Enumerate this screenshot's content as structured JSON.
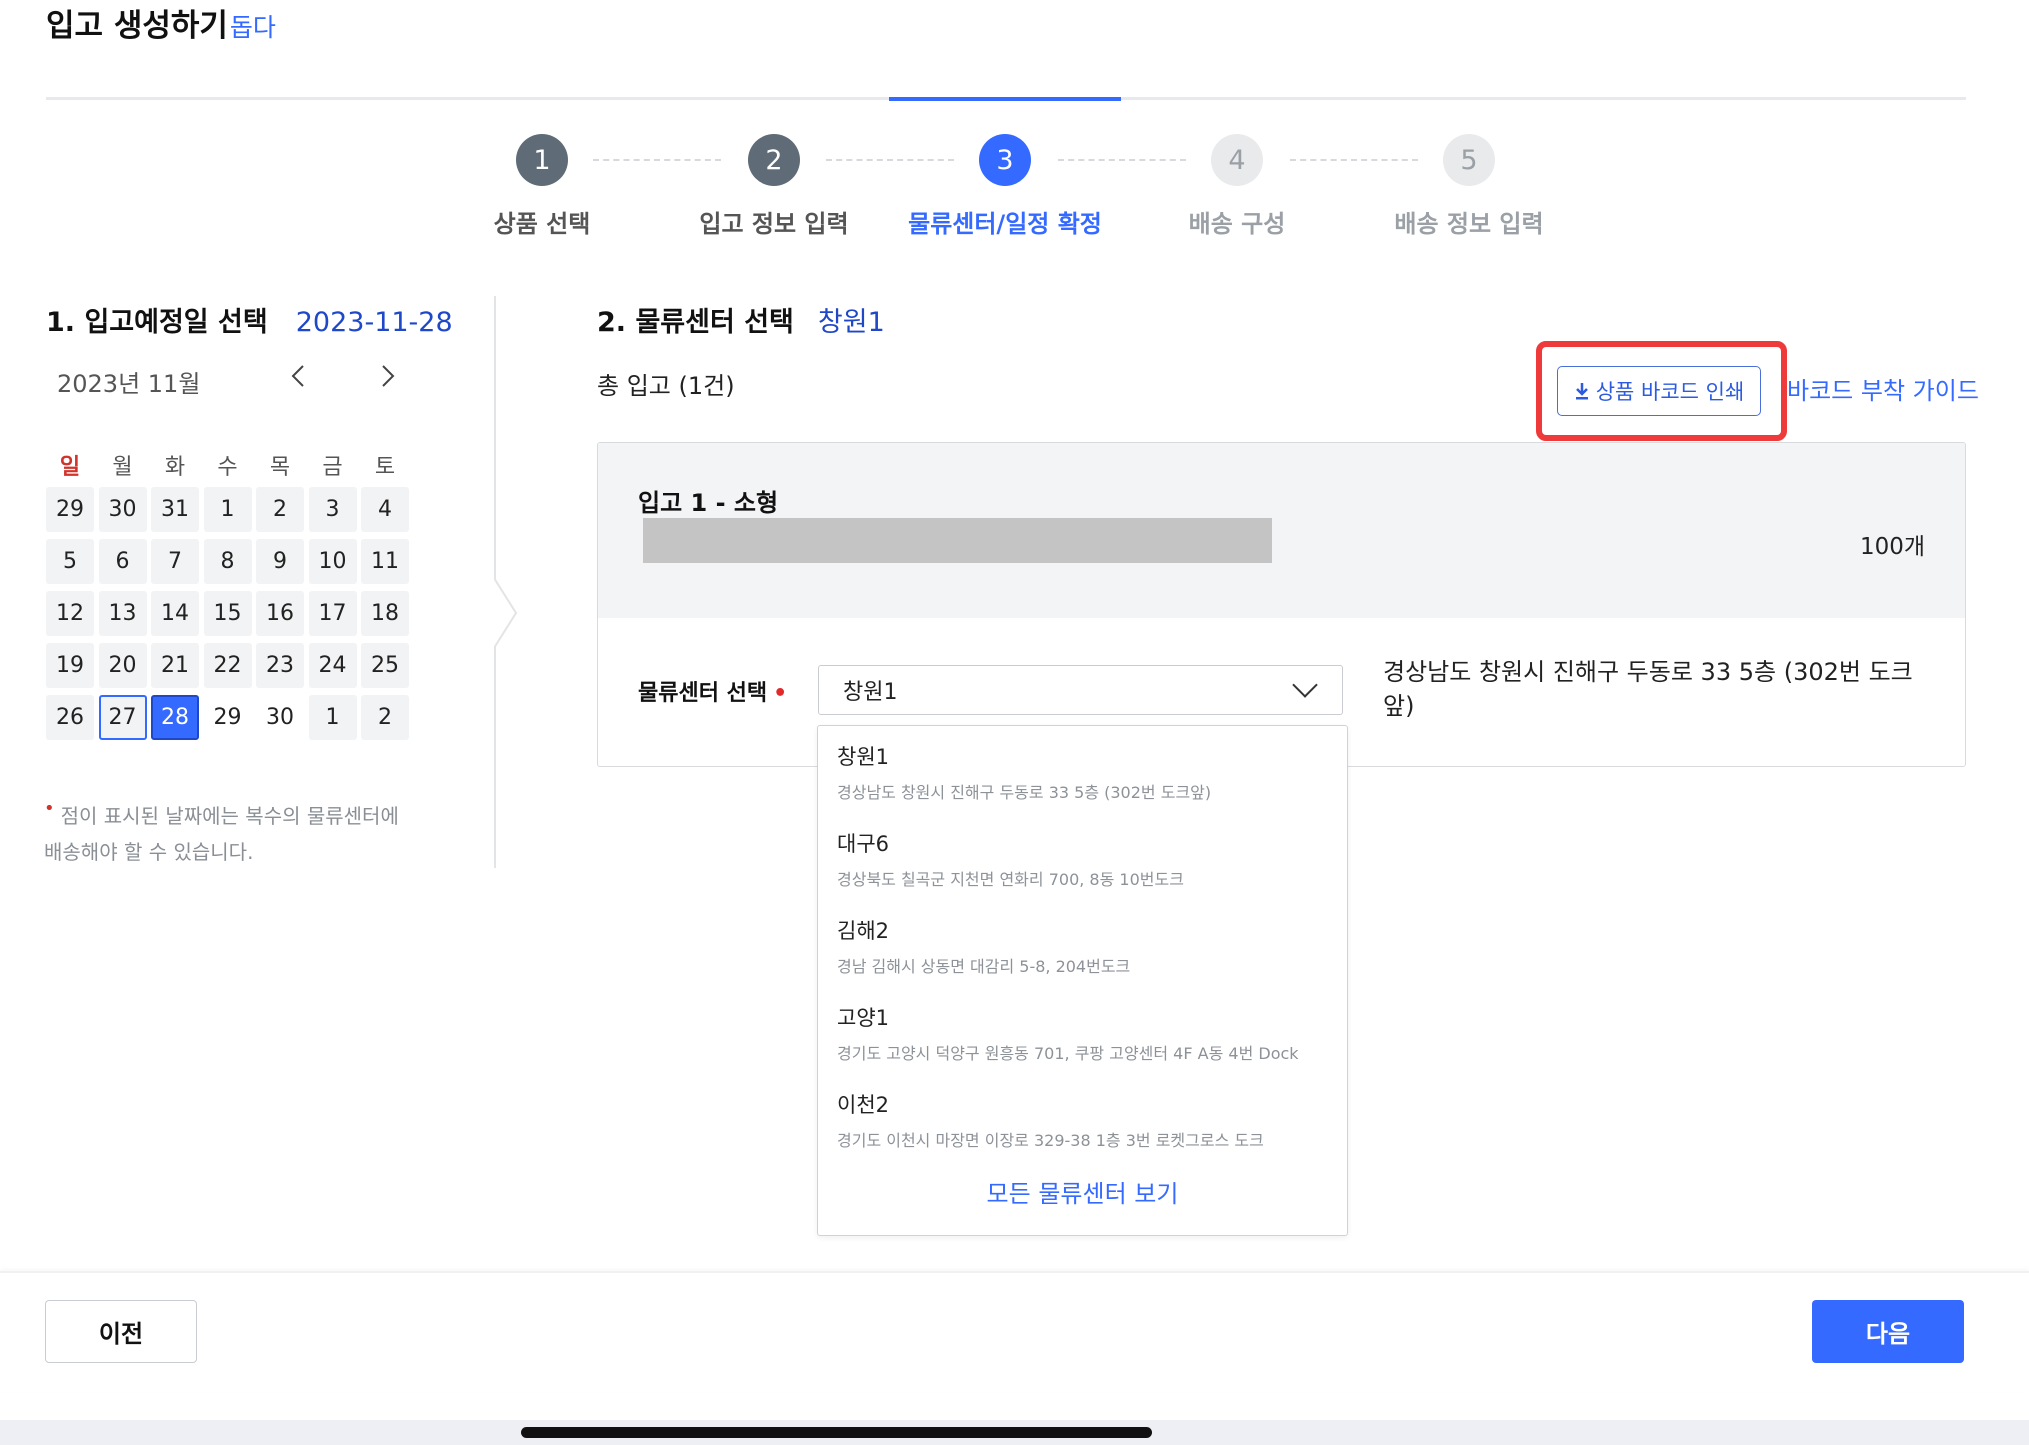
{
  "page": {
    "title": "입고 생성하기",
    "help_link": "돕다"
  },
  "steps": [
    {
      "num": "1",
      "label": "상품 선택",
      "state": "done"
    },
    {
      "num": "2",
      "label": "입고 정보 입력",
      "state": "done"
    },
    {
      "num": "3",
      "label": "물류센터/일정 확정",
      "state": "active"
    },
    {
      "num": "4",
      "label": "배송 구성",
      "state": "todo"
    },
    {
      "num": "5",
      "label": "배송 정보 입력",
      "state": "todo"
    }
  ],
  "date_section": {
    "title": "1. 입고예정일 선택",
    "selected_date": "2023-11-28",
    "month_label": "2023년 11월",
    "prev_icon": "‹",
    "next_icon": "›",
    "weekdays": [
      "일",
      "월",
      "화",
      "수",
      "목",
      "금",
      "토"
    ],
    "days": [
      "29",
      "30",
      "31",
      "1",
      "2",
      "3",
      "4",
      "5",
      "6",
      "7",
      "8",
      "9",
      "10",
      "11",
      "12",
      "13",
      "14",
      "15",
      "16",
      "17",
      "18",
      "19",
      "20",
      "21",
      "22",
      "23",
      "24",
      "25",
      "26",
      "27",
      "28",
      "29",
      "30",
      "1",
      "2"
    ],
    "today_day": "27",
    "selected_day": "28",
    "note": "점이 표시된 날짜에는 복수의 물류센터에 배송해야 할 수 있습니다."
  },
  "center_section": {
    "title": "2. 물류센터 선택",
    "selected_center": "창원1",
    "total_label": "총 입고 (1건)",
    "barcode_button": "상품 바코드 인쇄",
    "guide_link": "바코드 부착 가이드",
    "card": {
      "title": "입고 1 - 소형",
      "quantity": "100개",
      "select_label": "물류센터 선택",
      "select_value": "창원1",
      "address": "경상남도 창원시 진해구 두동로 33 5층 (302번 도크앞)"
    },
    "dropdown": {
      "options": [
        {
          "name": "창원1",
          "address": "경상남도 창원시 진해구 두동로 33 5층 (302번 도크앞)"
        },
        {
          "name": "대구6",
          "address": "경상북도 칠곡군 지천면 연화리 700, 8동 10번도크"
        },
        {
          "name": "김해2",
          "address": "경남 김해시 상동면 대감리 5-8, 204번도크"
        },
        {
          "name": "고양1",
          "address": "경기도 고양시 덕양구 원흥동 701, 쿠팡 고양센터 4F A동 4번 Dock"
        },
        {
          "name": "이천2",
          "address": "경기도 이천시 마장면 이장로 329-38 1층 3번 로켓그로스 도크"
        }
      ],
      "view_all": "모든 물류센터 보기"
    }
  },
  "footer": {
    "prev_label": "이전",
    "next_label": "다음"
  },
  "colors": {
    "accent": "#346aff",
    "highlight": "#ee3a3a",
    "sunday": "#d2342b"
  }
}
